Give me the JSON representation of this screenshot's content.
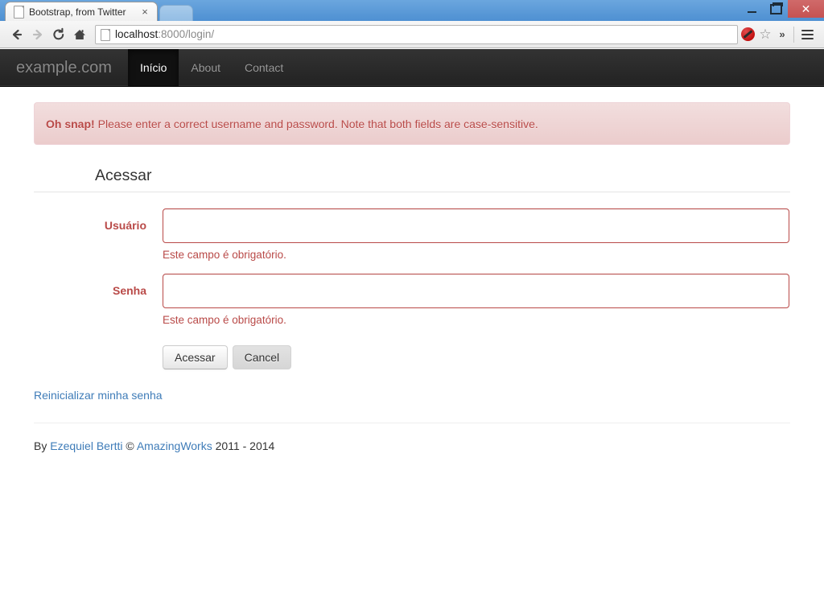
{
  "browser": {
    "tab": {
      "title": "Bootstrap, from Twitter",
      "favicon": "page-icon",
      "close_label": "×"
    },
    "window_controls": {
      "minimize_label": "",
      "maximize_label": "",
      "close_label": "✕"
    },
    "toolbar": {
      "back_icon": "back-arrow-icon",
      "forward_icon": "forward-arrow-icon",
      "reload_icon": "reload-icon",
      "home_icon": "home-icon",
      "url_host": "localhost",
      "url_path": ":8000/login/",
      "url_full": "localhost:8000/login/",
      "blocked_icon": "blocked-plugin-icon",
      "bookmark_icon": "☆",
      "overflow_label": "»",
      "menu_icon": "hamburger-menu-icon"
    }
  },
  "site_nav": {
    "brand": "example.com",
    "items": [
      {
        "label": "Início",
        "active": true
      },
      {
        "label": "About",
        "active": false
      },
      {
        "label": "Contact",
        "active": false
      }
    ]
  },
  "alert": {
    "strong": "Oh snap!",
    "message": "Please enter a correct username and password. Note that both fields are case-sensitive."
  },
  "form": {
    "legend": "Acessar",
    "fields": [
      {
        "label": "Usuário",
        "value": "",
        "placeholder": "",
        "help": "Este campo é obrigatório."
      },
      {
        "label": "Senha",
        "value": "",
        "placeholder": "",
        "help": "Este campo é obrigatório."
      }
    ],
    "submit_label": "Acessar",
    "cancel_label": "Cancel"
  },
  "links": {
    "reset_password": "Reinicializar minha senha"
  },
  "footer": {
    "prefix": "By ",
    "author": "Ezequiel Bertti",
    "copyright_symbol": " © ",
    "company": "AmazingWorks",
    "years": " 2011 - 2014"
  },
  "colors": {
    "error_red": "#b94a48",
    "alert_bg": "#f2dede",
    "alert_border": "#eed3d7",
    "link_blue": "#3f7cb8",
    "navbar_dark": "#222222",
    "titlebar_blue": "#5b9bd9",
    "close_button_red": "#cc5b5b"
  }
}
